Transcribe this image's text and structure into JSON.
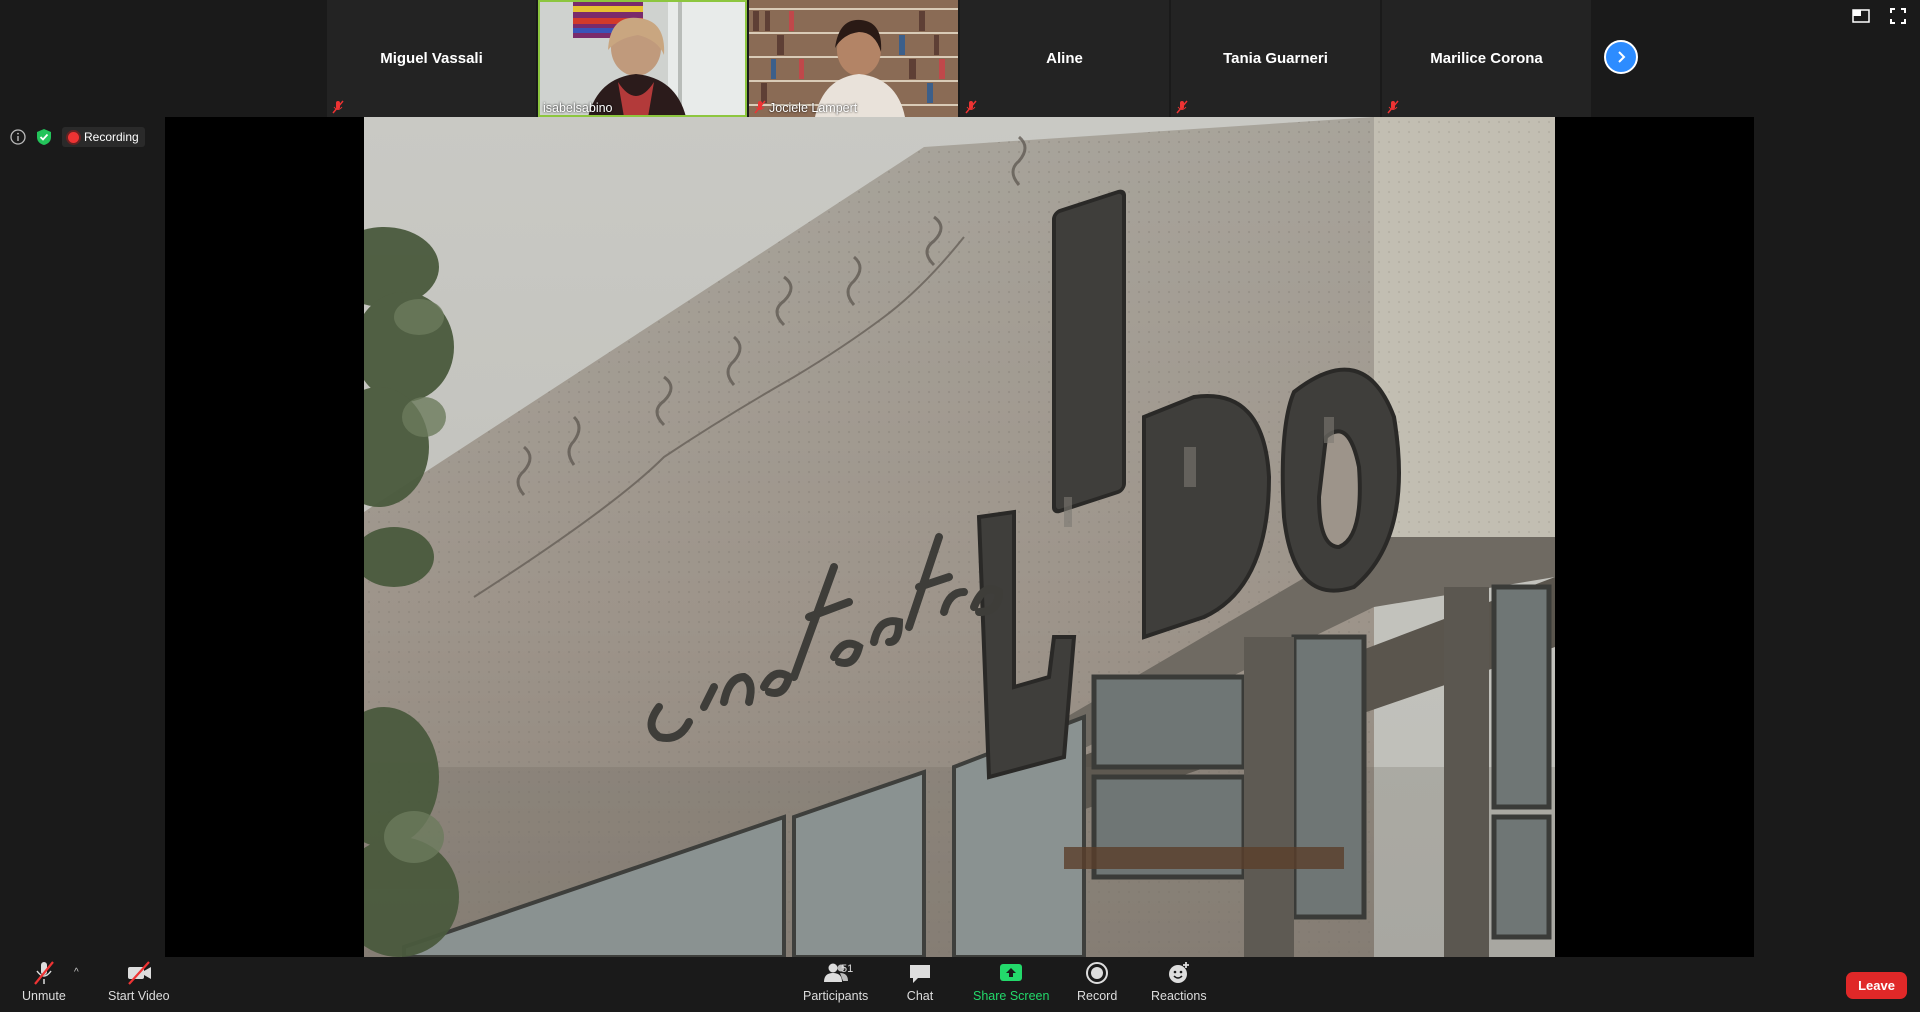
{
  "participants": [
    {
      "name": "Miguel Vassali",
      "muted": true,
      "video": false
    },
    {
      "name": "isabelsabino",
      "muted": false,
      "video": true,
      "active": true
    },
    {
      "name": "Jociele Lampert",
      "muted": true,
      "video": true
    },
    {
      "name": "Aline",
      "muted": true,
      "video": false
    },
    {
      "name": "Tania Guarneri",
      "muted": true,
      "video": false
    },
    {
      "name": "Marilice Corona",
      "muted": true,
      "video": false
    }
  ],
  "meeting": {
    "recording_label": "Recording"
  },
  "shared_content": {
    "sign_text": "cine teatro LIDO"
  },
  "toolbar": {
    "unmute_label": "Unmute",
    "start_video_label": "Start Video",
    "participants_label": "Participants",
    "participants_count": "51",
    "chat_label": "Chat",
    "share_screen_label": "Share Screen",
    "record_label": "Record",
    "reactions_label": "Reactions",
    "leave_label": "Leave"
  },
  "colors": {
    "accent_blue": "#2d8cff",
    "leave_red": "#e02828",
    "share_green": "#23d96b",
    "active_speaker": "#8dc63f"
  }
}
